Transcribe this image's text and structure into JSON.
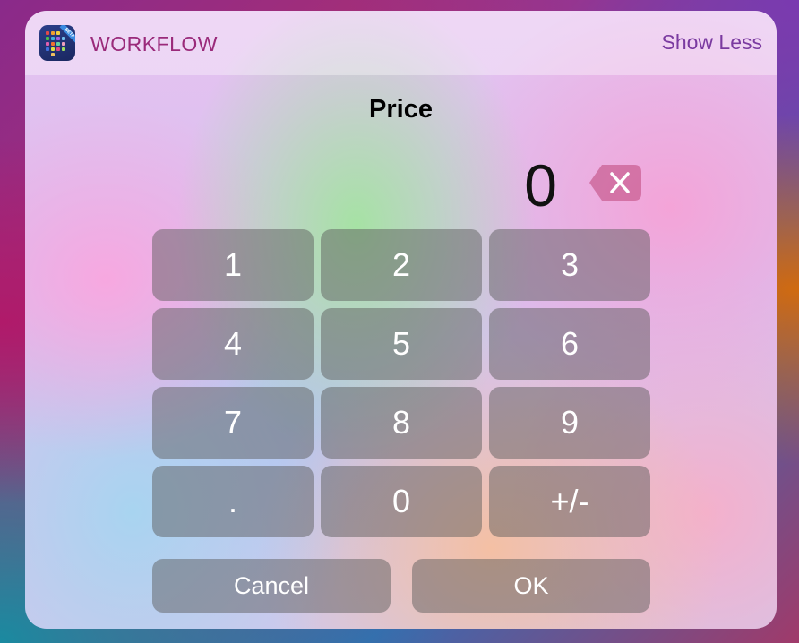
{
  "header": {
    "app_name": "WORKFLOW",
    "show_less_label": "Show Less",
    "app_icon": "workflow-app-icon",
    "badge_text": "BETA"
  },
  "dialog": {
    "title": "Price",
    "value": "0",
    "backspace_icon": "backspace-icon"
  },
  "keypad": {
    "keys": [
      "1",
      "2",
      "3",
      "4",
      "5",
      "6",
      "7",
      "8",
      "9",
      ".",
      "0",
      "+/-"
    ]
  },
  "actions": {
    "cancel_label": "Cancel",
    "ok_label": "OK"
  },
  "colors": {
    "app_name": "#9a2a7a",
    "show_less": "#7a3aa0",
    "key_background": "rgba(90,90,90,0.48)"
  }
}
